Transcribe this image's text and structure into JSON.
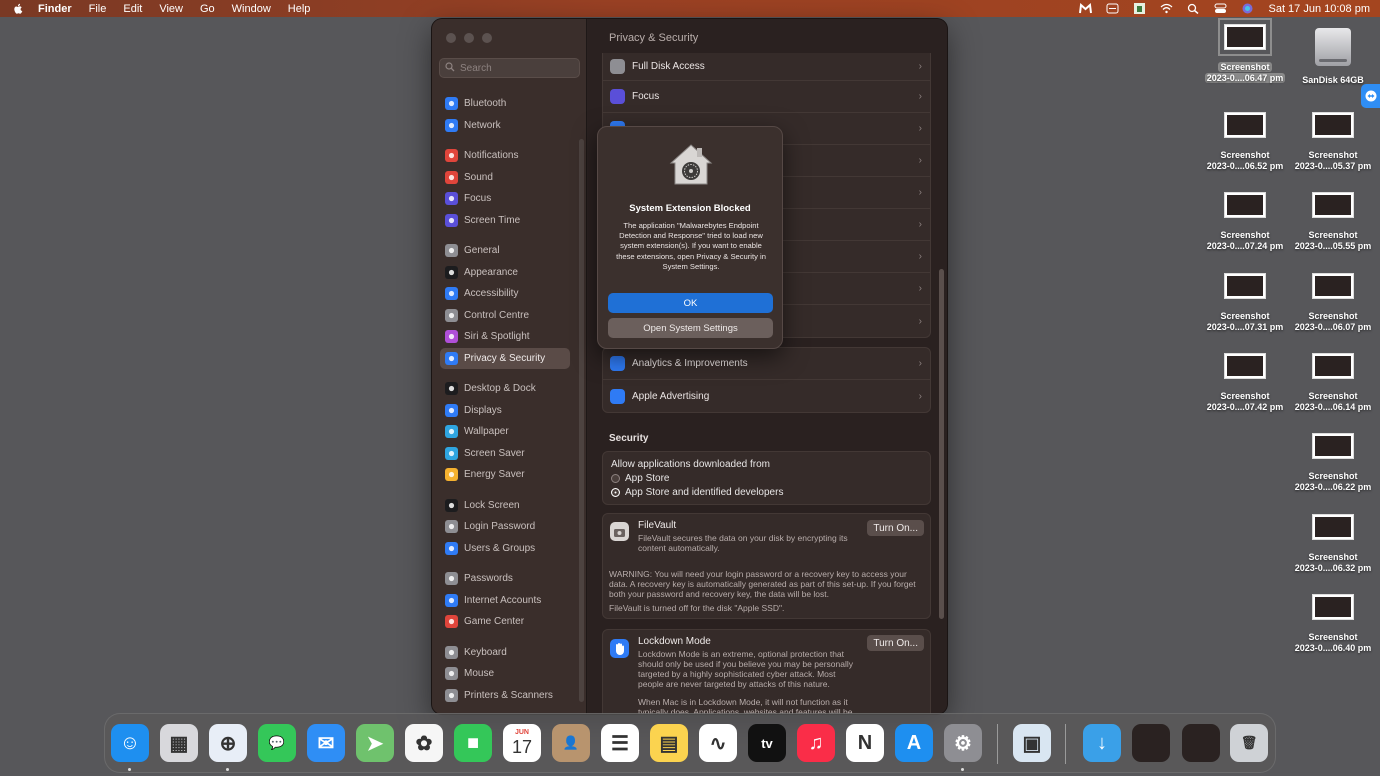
{
  "menubar": {
    "app": "Finder",
    "items": [
      "File",
      "Edit",
      "View",
      "Go",
      "Window",
      "Help"
    ],
    "clock": "Sat 17 Jun  10:08 pm"
  },
  "window": {
    "title": "Privacy & Security",
    "search_placeholder": "Search",
    "sidebar": [
      {
        "label": "Bluetooth",
        "icon": "bluetooth-icon",
        "color": "#2f7bf5"
      },
      {
        "label": "Network",
        "icon": "globe-icon",
        "color": "#2f7bf5"
      },
      {
        "gap": true
      },
      {
        "label": "Notifications",
        "icon": "bell-icon",
        "color": "#e0453b"
      },
      {
        "label": "Sound",
        "icon": "speaker-icon",
        "color": "#e0453b"
      },
      {
        "label": "Focus",
        "icon": "moon-icon",
        "color": "#5a4fd8"
      },
      {
        "label": "Screen Time",
        "icon": "hourglass-icon",
        "color": "#5a4fd8"
      },
      {
        "gap": true
      },
      {
        "label": "General",
        "icon": "gear-icon",
        "color": "#8e8e93"
      },
      {
        "label": "Appearance",
        "icon": "appearance-icon",
        "color": "#1c1c1e"
      },
      {
        "label": "Accessibility",
        "icon": "accessibility-icon",
        "color": "#2f7bf5"
      },
      {
        "label": "Control Centre",
        "icon": "control-centre-icon",
        "color": "#8e8e93"
      },
      {
        "label": "Siri & Spotlight",
        "icon": "siri-icon",
        "color": "#b04fd8"
      },
      {
        "label": "Privacy & Security",
        "icon": "hand-icon",
        "color": "#2f7bf5",
        "selected": true
      },
      {
        "gap": true
      },
      {
        "label": "Desktop & Dock",
        "icon": "dock-icon",
        "color": "#1c1c1e"
      },
      {
        "label": "Displays",
        "icon": "display-icon",
        "color": "#2f7bf5"
      },
      {
        "label": "Wallpaper",
        "icon": "wallpaper-icon",
        "color": "#2fa5e0"
      },
      {
        "label": "Screen Saver",
        "icon": "screensaver-icon",
        "color": "#2fa5e0"
      },
      {
        "label": "Energy Saver",
        "icon": "battery-icon",
        "color": "#f5b12f"
      },
      {
        "gap": true
      },
      {
        "label": "Lock Screen",
        "icon": "lock-icon",
        "color": "#1c1c1e"
      },
      {
        "label": "Login Password",
        "icon": "password-icon",
        "color": "#8e8e93"
      },
      {
        "label": "Users & Groups",
        "icon": "users-icon",
        "color": "#2f7bf5"
      },
      {
        "gap": true
      },
      {
        "label": "Passwords",
        "icon": "key-icon",
        "color": "#8e8e93"
      },
      {
        "label": "Internet Accounts",
        "icon": "at-icon",
        "color": "#2f7bf5"
      },
      {
        "label": "Game Center",
        "icon": "game-center-icon",
        "color": "#e0453b"
      },
      {
        "gap": true
      },
      {
        "label": "Keyboard",
        "icon": "keyboard-icon",
        "color": "#8e8e93"
      },
      {
        "label": "Mouse",
        "icon": "mouse-icon",
        "color": "#8e8e93"
      },
      {
        "label": "Printers & Scanners",
        "icon": "printer-icon",
        "color": "#8e8e93"
      }
    ],
    "privacy_rows_top": [
      {
        "label": "Full Disk Access",
        "icon": "disk-icon",
        "color": "#8e8e93"
      },
      {
        "label": "Focus",
        "icon": "moon-icon",
        "color": "#5a4fd8"
      },
      {
        "label": "",
        "icon": "app-icon",
        "color": "#2f7bf5"
      },
      {
        "label": "",
        "icon": "app-icon",
        "color": "#2f7bf5"
      },
      {
        "label": "",
        "icon": "app-icon",
        "color": "#2f7bf5"
      },
      {
        "label": "",
        "icon": "app-icon",
        "color": "#2f7bf5"
      },
      {
        "label": "",
        "icon": "app-icon",
        "color": "#2f7bf5"
      },
      {
        "label": "",
        "icon": "app-icon",
        "color": "#2f7bf5"
      },
      {
        "label": "",
        "icon": "app-icon",
        "color": "#2f7bf5"
      }
    ],
    "privacy_rows_bottom": [
      {
        "label": "Analytics & Improvements",
        "icon": "analytics-icon",
        "color": "#2f7bf5"
      },
      {
        "label": "Apple Advertising",
        "icon": "megaphone-icon",
        "color": "#2f7bf5"
      }
    ],
    "security": {
      "heading": "Security",
      "allow_label": "Allow applications downloaded from",
      "options": [
        "App Store",
        "App Store and identified developers"
      ],
      "selected_option": "App Store and identified developers",
      "filevault": {
        "title": "FileVault",
        "desc": "FileVault secures the data on your disk by encrypting its content automatically.",
        "button": "Turn On...",
        "warning": "WARNING: You will need your login password or a recovery key to access your data. A recovery key is automatically generated as part of this set-up. If you forget both your password and recovery key, the data will be lost.",
        "status": "FileVault is turned off for the disk \"Apple SSD\"."
      },
      "lockdown": {
        "title": "Lockdown Mode",
        "desc": "Lockdown Mode is an extreme, optional protection that should only be used if you believe you may be personally targeted by a highly sophisticated cyber attack. Most people are never targeted by attacks of this nature.",
        "desc2": "When Mac is in Lockdown Mode, it will not function as it typically does. Applications, websites and features will be",
        "button": "Turn On..."
      }
    }
  },
  "alert": {
    "title": "System Extension Blocked",
    "message": "The application \"Malwarebytes Endpoint Detection and Response\" tried to load new system extension(s). If you want to enable these extensions, open Privacy & Security in System Settings.",
    "ok": "OK",
    "open": "Open System Settings"
  },
  "desktop": [
    {
      "line1": "Screenshot",
      "line2": "2023-0....06.47 pm",
      "selected": true
    },
    {
      "line1": "SanDisk 64GB",
      "line2": "",
      "drive": true
    },
    {
      "line1": "Screenshot",
      "line2": "2023-0....06.52 pm"
    },
    {
      "line1": "Screenshot",
      "line2": "2023-0....05.37 pm"
    },
    {
      "line1": "Screenshot",
      "line2": "2023-0....07.24 pm"
    },
    {
      "line1": "Screenshot",
      "line2": "2023-0....05.55 pm"
    },
    {
      "line1": "Screenshot",
      "line2": "2023-0....07.31 pm"
    },
    {
      "line1": "Screenshot",
      "line2": "2023-0....06.07 pm"
    },
    {
      "line1": "Screenshot",
      "line2": "2023-0....07.42 pm"
    },
    {
      "line1": "Screenshot",
      "line2": "2023-0....06.14 pm"
    },
    {
      "line1": "Screenshot",
      "line2": "2023-0....06.22 pm"
    },
    {
      "line1": "Screenshot",
      "line2": "2023-0....06.32 pm"
    },
    {
      "line1": "Screenshot",
      "line2": "2023-0....06.40 pm"
    }
  ],
  "dock": {
    "apps": [
      {
        "name": "finder-icon",
        "color": "#1e8ff0",
        "glyph": "☺",
        "running": true
      },
      {
        "name": "launchpad-icon",
        "color": "#d8d8dc",
        "glyph": "▦"
      },
      {
        "name": "safari-icon",
        "color": "#e8eef7",
        "glyph": "⊕",
        "running": true
      },
      {
        "name": "messages-icon",
        "color": "#34c759",
        "glyph": "💬"
      },
      {
        "name": "mail-icon",
        "color": "#2f8ef5",
        "glyph": "✉"
      },
      {
        "name": "maps-icon",
        "color": "#6fc26d",
        "glyph": "➤"
      },
      {
        "name": "photos-icon",
        "color": "#f6f6f6",
        "glyph": "✿"
      },
      {
        "name": "facetime-icon",
        "color": "#34c759",
        "glyph": "■"
      },
      {
        "name": "calendar-icon",
        "color": "#ffffff",
        "glyph": "17",
        "month": "JUN"
      },
      {
        "name": "contacts-icon",
        "color": "#b8946e",
        "glyph": "👤"
      },
      {
        "name": "reminders-icon",
        "color": "#ffffff",
        "glyph": "☰"
      },
      {
        "name": "notes-icon",
        "color": "#fbd34f",
        "glyph": "▤"
      },
      {
        "name": "freeform-icon",
        "color": "#ffffff",
        "glyph": "∿"
      },
      {
        "name": "tv-icon",
        "color": "#111111",
        "glyph": "tv"
      },
      {
        "name": "music-icon",
        "color": "#fa2d48",
        "glyph": "♫"
      },
      {
        "name": "news-icon",
        "color": "#ffffff",
        "glyph": "N"
      },
      {
        "name": "app-store-icon",
        "color": "#1e8ff0",
        "glyph": "A"
      },
      {
        "name": "system-settings-icon",
        "color": "#8e8e93",
        "glyph": "⚙",
        "running": true
      },
      {
        "name": "preview-icon",
        "color": "#d9e6f2",
        "glyph": "▣"
      },
      {
        "name": "downloads-folder-icon",
        "color": "#3aa0e8",
        "glyph": "↓"
      },
      {
        "name": "stack-screenshots-icon",
        "color": "#2a2221",
        "glyph": ""
      },
      {
        "name": "recent-screenshot-icon",
        "color": "#2a2221",
        "glyph": ""
      },
      {
        "name": "trash-icon",
        "color": "#cfd2d6",
        "glyph": "🗑"
      }
    ]
  }
}
